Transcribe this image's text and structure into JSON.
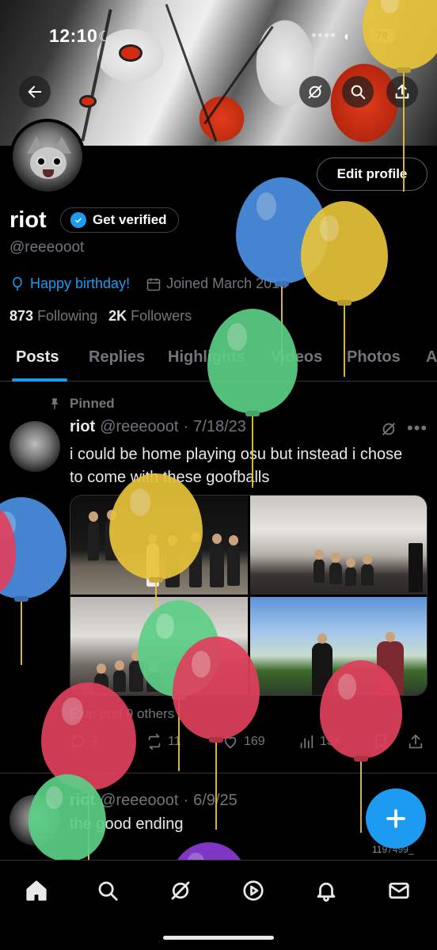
{
  "status": {
    "time": "12:10",
    "battery": "79"
  },
  "profile": {
    "name": "riot",
    "verify_label": "Get verified",
    "handle": "@reeeooot",
    "birthday": "Happy birthday!",
    "joined": "Joined March 2018",
    "following_count": "873",
    "following_label": "Following",
    "followers_count": "2K",
    "followers_label": "Followers",
    "edit_label": "Edit profile"
  },
  "tabs": [
    {
      "label": "Posts",
      "active": true
    },
    {
      "label": "Replies"
    },
    {
      "label": "Highlights"
    },
    {
      "label": "Videos"
    },
    {
      "label": "Photos"
    },
    {
      "label": "A"
    }
  ],
  "posts": [
    {
      "pinned_label": "Pinned",
      "name": "riot",
      "handle": "@reeeooot",
      "date": "7/18/23",
      "text": "i could be home playing osu but instead i chose to come with these goofballs",
      "tagged": "Exai and 9 others",
      "replies": "7",
      "reposts": "11",
      "likes": "169",
      "views": "13K"
    },
    {
      "name": "riot",
      "handle": "@reeeooot",
      "date": "6/9/25",
      "text": "the good ending",
      "mini_handle": "1197499_"
    }
  ],
  "icons": {
    "back": "arrow-left-icon",
    "grok": "grok-icon",
    "search": "search-icon",
    "share": "share-icon",
    "pin": "pin-icon",
    "nav": [
      "home-icon",
      "search-icon",
      "grok-icon",
      "video-icon",
      "bell-icon",
      "mail-icon"
    ]
  },
  "colors": {
    "accent": "#1d9bf0",
    "background": "#000000",
    "balloon_blue": "#4a90e2",
    "balloon_yellow": "#e8c33a",
    "balloon_green": "#5ccf86",
    "balloon_red": "#e0405c",
    "balloon_purple": "#8a3bd6"
  }
}
